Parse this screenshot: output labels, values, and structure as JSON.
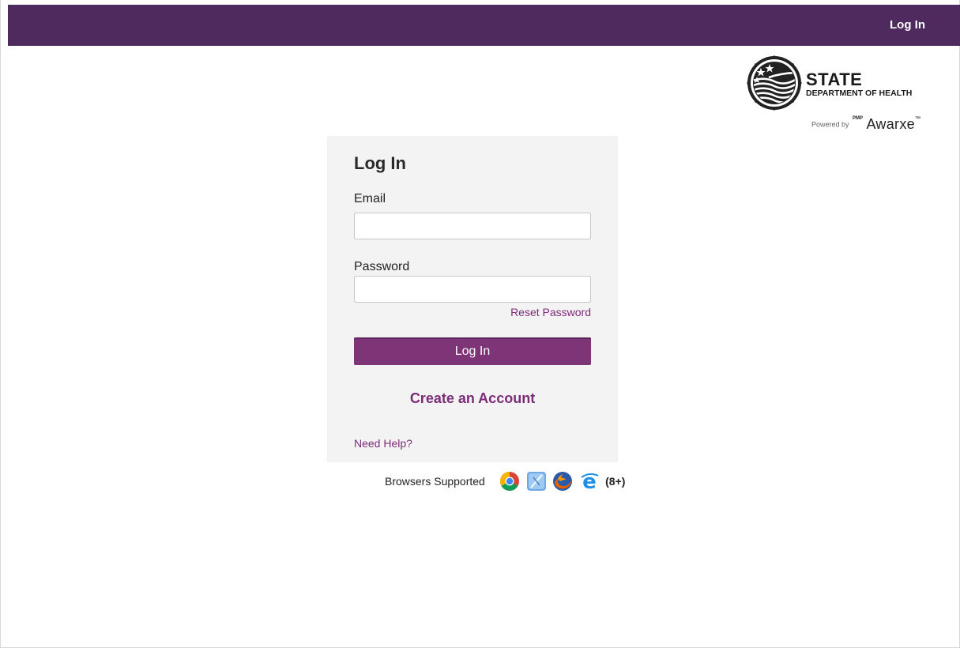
{
  "topbar": {
    "login_label": "Log In"
  },
  "brand": {
    "title": "STATE",
    "subtitle": "DEPARTMENT OF HEALTH",
    "powered_by": "Powered by",
    "pmp_mark": "PMP",
    "product": "Awarxe",
    "trademark": "™"
  },
  "form": {
    "title": "Log In",
    "email_label": "Email",
    "email_value": "",
    "password_label": "Password",
    "password_value": "",
    "reset_label": "Reset Password",
    "submit_label": "Log In",
    "create_label": "Create an Account",
    "help_label": "Need Help?"
  },
  "browsers": {
    "label": "Browsers Supported",
    "icons": [
      "chrome-icon",
      "safari-icon",
      "firefox-icon",
      "internet-explorer-icon"
    ],
    "version_note": "(8+)"
  },
  "colors": {
    "topbar": "#4e2a5e",
    "accent": "#7d3578",
    "link": "#7d2b78",
    "card_bg": "#f3f3f3"
  }
}
